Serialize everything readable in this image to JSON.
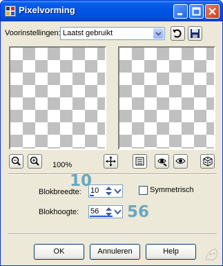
{
  "window": {
    "title": "Pixelvorming"
  },
  "presets": {
    "label": "Voorinstellingen:",
    "value": "Laatst gebruikt"
  },
  "zoom": {
    "level": "100%"
  },
  "block_width": {
    "label": "Blokbreedte:",
    "value": "10",
    "display": "10"
  },
  "block_height": {
    "label": "Blokhoogte:",
    "value": "56",
    "display": "56"
  },
  "symmetric": {
    "label": "Symmetrisch",
    "checked": false
  },
  "buttons": {
    "ok": "OK",
    "cancel": "Annuleren",
    "help": "Help"
  },
  "icons": {
    "preset_load": "reset-arrow-icon",
    "preset_save": "floppy-save-icon",
    "zoom_out": "zoom-out-icon",
    "zoom_in": "zoom-in-icon",
    "pan": "move-icon",
    "toggle_preview": "preview-toggle-icon",
    "proof_auto": "auto-proof-icon",
    "proof": "proof-eye-icon",
    "randomize": "dice-icon"
  }
}
